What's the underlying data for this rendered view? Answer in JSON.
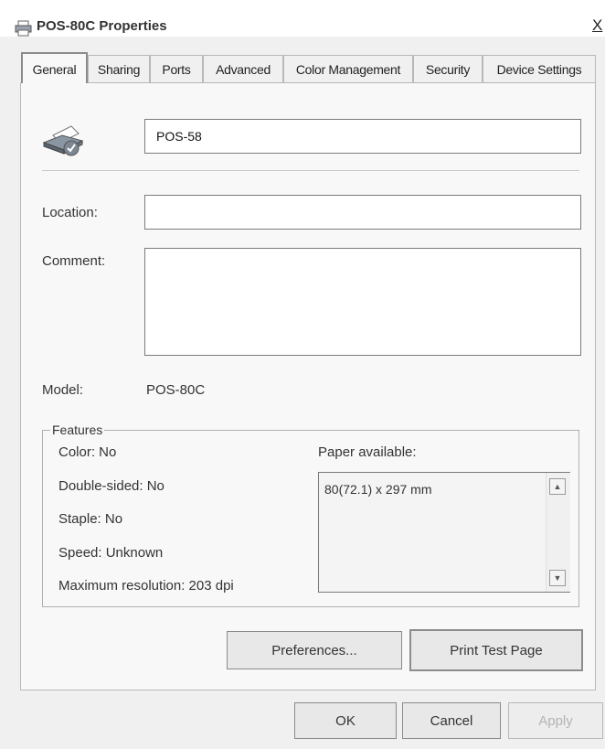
{
  "window": {
    "title": "POS-80C Properties",
    "close_label": "X"
  },
  "tabs": [
    {
      "label": "General"
    },
    {
      "label": "Sharing"
    },
    {
      "label": "Ports"
    },
    {
      "label": "Advanced"
    },
    {
      "label": "Color Management"
    },
    {
      "label": "Security"
    },
    {
      "label": "Device Settings"
    }
  ],
  "general": {
    "printer_name": "POS-58",
    "location_label": "Location:",
    "location_value": "",
    "comment_label": "Comment:",
    "comment_value": "",
    "model_label": "Model:",
    "model_value": "POS-80C"
  },
  "features": {
    "legend": "Features",
    "color": "Color: No",
    "double_sided": "Double-sided: No",
    "staple": "Staple: No",
    "speed": "Speed: Unknown",
    "max_resolution": "Maximum resolution: 203 dpi",
    "paper_label": "Paper available:",
    "paper_items": [
      "80(72.1) x 297 mm"
    ]
  },
  "buttons": {
    "preferences": "Preferences...",
    "print_test": "Print Test Page",
    "ok": "OK",
    "cancel": "Cancel",
    "apply": "Apply"
  },
  "colors": {
    "background": "#f0f0f0",
    "panel": "#f8f8f8",
    "border": "#8c8c8c"
  },
  "icons": {
    "app": "printer-icon",
    "printer": "printer-check-icon"
  }
}
